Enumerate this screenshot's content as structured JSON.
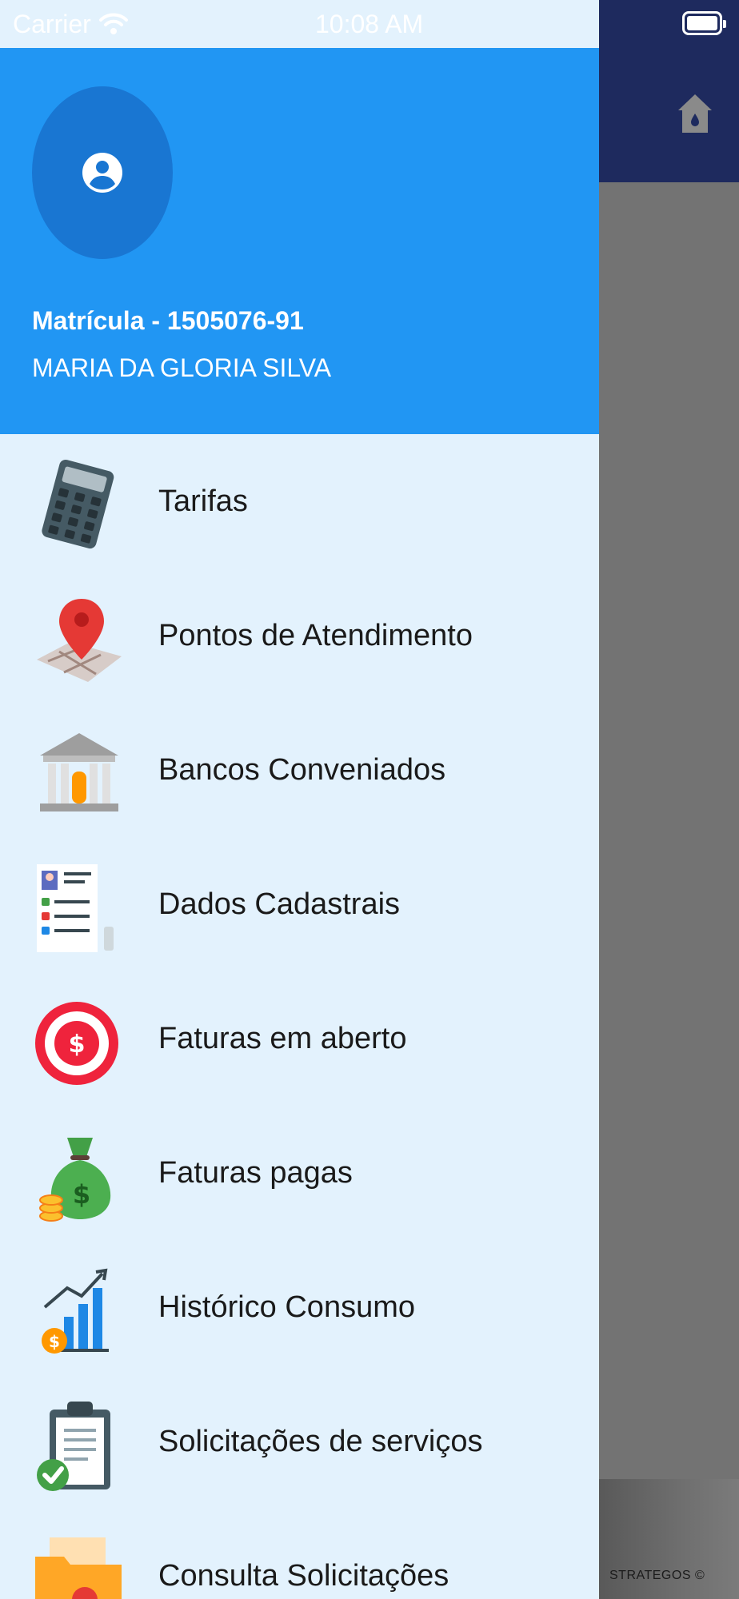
{
  "status_bar": {
    "carrier": "Carrier",
    "time": "10:08 AM"
  },
  "drawer": {
    "registration": "Matrícula - 1505076-91",
    "user_name": "MARIA DA GLORIA SILVA",
    "items": [
      {
        "label": "Tarifas",
        "icon": "calculator-icon"
      },
      {
        "label": "Pontos de Atendimento",
        "icon": "map-pin-icon"
      },
      {
        "label": "Bancos Conveniados",
        "icon": "bank-icon"
      },
      {
        "label": "Dados Cadastrais",
        "icon": "profile-card-icon"
      },
      {
        "label": "Faturas em aberto",
        "icon": "target-dollar-icon"
      },
      {
        "label": "Faturas pagas",
        "icon": "money-bag-icon"
      },
      {
        "label": "Histórico Consumo",
        "icon": "chart-growth-icon"
      },
      {
        "label": "Solicitações de serviços",
        "icon": "clipboard-check-icon"
      },
      {
        "label": "Consulta Solicitações",
        "icon": "folder-icon"
      }
    ]
  },
  "background": {
    "footer_text": "STRATEGOS ©"
  },
  "colors": {
    "header": "#2196f3",
    "drawer_bg": "#e3f2fd",
    "navbar": "#1e2a5e",
    "overlay": "#737373"
  }
}
